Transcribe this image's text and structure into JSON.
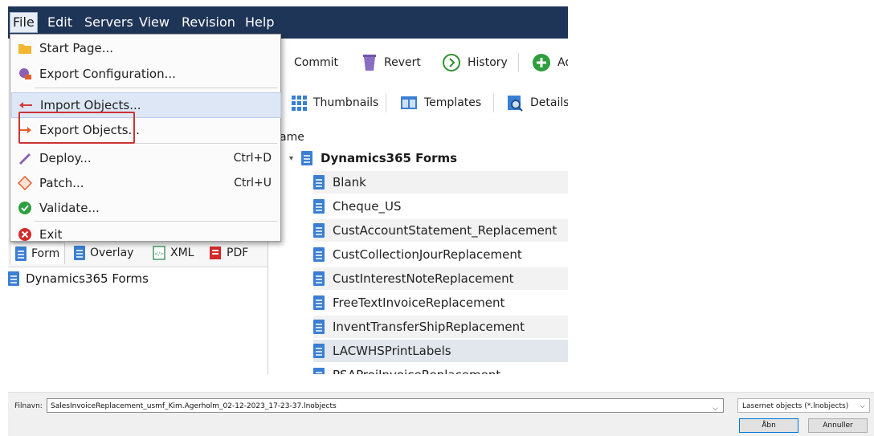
{
  "menubar": {
    "items": [
      "File",
      "Edit",
      "Servers",
      "View",
      "Revision",
      "Help"
    ]
  },
  "file_menu": {
    "items": [
      {
        "label": "Start Page...",
        "shortcut": "",
        "icon": "folder-icon"
      },
      {
        "label": "Export Configuration...",
        "shortcut": "",
        "icon": "export-config-icon"
      },
      {
        "label": "Import Objects...",
        "shortcut": "",
        "icon": "import-arrow-icon"
      },
      {
        "label": "Export Objects...",
        "shortcut": "",
        "icon": "export-arrow-icon"
      },
      {
        "label": "Deploy...",
        "shortcut": "Ctrl+D",
        "icon": "deploy-icon"
      },
      {
        "label": "Patch...",
        "shortcut": "Ctrl+U",
        "icon": "patch-icon"
      },
      {
        "label": "Validate...",
        "shortcut": "",
        "icon": "validate-check-icon"
      },
      {
        "label": "Exit",
        "shortcut": "",
        "icon": "exit-icon"
      }
    ],
    "highlighted": "Import Objects..."
  },
  "toolbar_row1": {
    "commit": "Commit",
    "revert": "Revert",
    "history": "History",
    "add": "Ad"
  },
  "toolbar_row2": {
    "thumbnails": "Thumbnails",
    "templates": "Templates",
    "details": "Details"
  },
  "list": {
    "header": "ame",
    "root": "Dynamics365 Forms",
    "items": [
      "Blank",
      "Cheque_US",
      "CustAccountStatement_Replacement",
      "CustCollectionJourReplacement",
      "CustInterestNoteReplacement",
      "FreeTextInvoiceReplacement",
      "InventTransferShipReplacement",
      "LACWHSPrintLabels",
      "PSAProjInvoiceReplacement"
    ],
    "selected": "LACWHSPrintLabels"
  },
  "left_pane": {
    "tabs": [
      "Form",
      "Overlay",
      "XML",
      "PDF"
    ],
    "active_tab": "Form",
    "tree_root": "Dynamics365 Forms"
  },
  "save_dialog": {
    "filename_label": "Filnavn:",
    "filename_value": "SalesInvoiceReplacement_usmf_Kim.Agerholm_02-12-2023_17-23-37.lnobjects",
    "filetype": "Lasernet objects (*.lnobjects)",
    "open_button": "Åbn",
    "cancel_button": "Annuller"
  },
  "colors": {
    "menubar_bg": "#1f3557",
    "highlight_box": "#cc3333",
    "doc_icon": "#3b7fd4"
  }
}
